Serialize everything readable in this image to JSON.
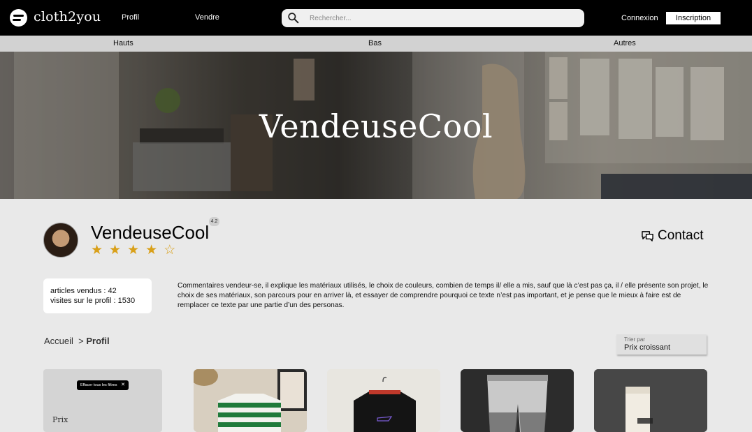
{
  "header": {
    "brand": "cloth2you",
    "nav": [
      "Profil",
      "Vendre"
    ],
    "search_placeholder": "Rechercher...",
    "login_label": "Connexion",
    "signup_label": "Inscription"
  },
  "categories": [
    "Hauts",
    "Bas",
    "Autres"
  ],
  "hero": {
    "title": "VendeuseCool"
  },
  "profile": {
    "name": "VendeuseCool",
    "rating": "4.2",
    "stars_filled": 4,
    "stars_total": 5,
    "contact_label": "Contact",
    "stats": {
      "sold_label": "articles vendus :",
      "sold_value": "42",
      "visits_label": "visites sur le profil :",
      "visits_value": "1530"
    },
    "description": "Commentaires vendeur-se, il explique les matériaux utilisés, le choix de couleurs, combien de temps il/ elle a mis, sauf que là c’est pas ça, il / elle présente son projet, le choix de ses matériaux, son parcours pour en arriver là, et essayer de comprendre pourquoi ce texte n’est pas important, et je pense que le mieux à faire est de remplacer ce texte par une partie d’un des personas."
  },
  "breadcrumb": {
    "home": "Accueil",
    "separator": ">",
    "current": "Profil"
  },
  "sort": {
    "label": "Trier par",
    "value": "Prix croissant"
  },
  "filters": {
    "clear_label": "Effacer tous les filtres",
    "price_label": "Prix"
  },
  "colors": {
    "header_bg": "#000000",
    "star": "#d9a019",
    "page_bg": "#e9e9e9"
  }
}
